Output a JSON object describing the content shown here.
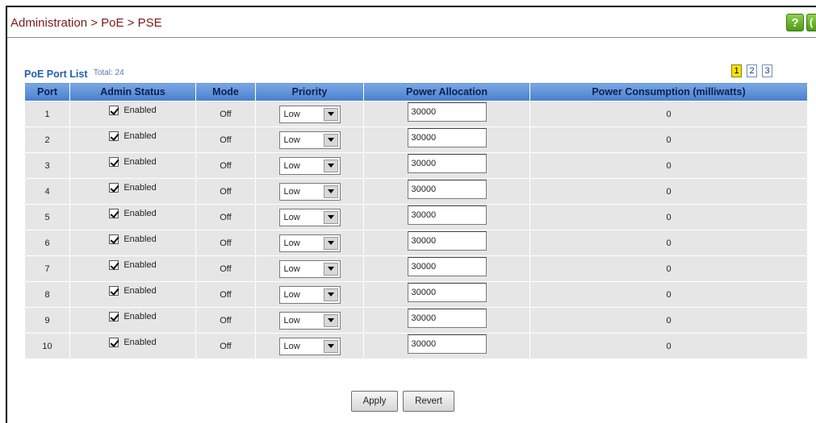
{
  "header": {
    "breadcrumb": "Administration > PoE > PSE",
    "help_label": "?",
    "extra_label": "(",
    "help_color": "#5aa82a"
  },
  "list": {
    "title": "PoE Port List",
    "total": "Total: 24"
  },
  "pager": {
    "pages": [
      "1",
      "2",
      "3"
    ],
    "active": "1"
  },
  "table": {
    "columns": [
      "Port",
      "Admin Status",
      "Mode",
      "Priority",
      "Power Allocation",
      "Power Consumption (milliwatts)"
    ],
    "rows": [
      {
        "port": "1",
        "admin_status": "Enabled",
        "mode": "Off",
        "priority": "Low",
        "power_allocation": "30000",
        "power_consumption": "0"
      },
      {
        "port": "2",
        "admin_status": "Enabled",
        "mode": "Off",
        "priority": "Low",
        "power_allocation": "30000",
        "power_consumption": "0"
      },
      {
        "port": "3",
        "admin_status": "Enabled",
        "mode": "Off",
        "priority": "Low",
        "power_allocation": "30000",
        "power_consumption": "0"
      },
      {
        "port": "4",
        "admin_status": "Enabled",
        "mode": "Off",
        "priority": "Low",
        "power_allocation": "30000",
        "power_consumption": "0"
      },
      {
        "port": "5",
        "admin_status": "Enabled",
        "mode": "Off",
        "priority": "Low",
        "power_allocation": "30000",
        "power_consumption": "0"
      },
      {
        "port": "6",
        "admin_status": "Enabled",
        "mode": "Off",
        "priority": "Low",
        "power_allocation": "30000",
        "power_consumption": "0"
      },
      {
        "port": "7",
        "admin_status": "Enabled",
        "mode": "Off",
        "priority": "Low",
        "power_allocation": "30000",
        "power_consumption": "0"
      },
      {
        "port": "8",
        "admin_status": "Enabled",
        "mode": "Off",
        "priority": "Low",
        "power_allocation": "30000",
        "power_consumption": "0"
      },
      {
        "port": "9",
        "admin_status": "Enabled",
        "mode": "Off",
        "priority": "Low",
        "power_allocation": "30000",
        "power_consumption": "0"
      },
      {
        "port": "10",
        "admin_status": "Enabled",
        "mode": "Off",
        "priority": "Low",
        "power_allocation": "30000",
        "power_consumption": "0"
      }
    ]
  },
  "buttons": {
    "apply": "Apply",
    "revert": "Revert"
  }
}
